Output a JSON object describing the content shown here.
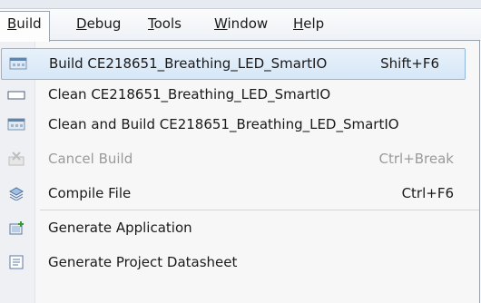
{
  "menubar": {
    "items": [
      {
        "label": "Build"
      },
      {
        "label": "Debug"
      },
      {
        "label": "Tools"
      },
      {
        "label": "Window"
      },
      {
        "label": "Help"
      }
    ]
  },
  "menu": {
    "items": [
      {
        "label": "Build CE218651_Breathing_LED_SmartIO",
        "shortcut": "Shift+F6",
        "icon": "build-icon"
      },
      {
        "label": "Clean CE218651_Breathing_LED_SmartIO",
        "icon": "clean-icon"
      },
      {
        "label": "Clean and Build CE218651_Breathing_LED_SmartIO",
        "icon": "clean-and-build-icon"
      },
      {
        "label": "Cancel Build",
        "shortcut": "Ctrl+Break",
        "icon": "cancel-build-icon"
      },
      {
        "label": "Compile File",
        "shortcut": "Ctrl+F6",
        "icon": "compile-file-icon"
      },
      {
        "label": "Generate Application",
        "icon": "generate-application-icon"
      },
      {
        "label": "Generate Project Datasheet",
        "icon": "generate-datasheet-icon"
      }
    ]
  }
}
